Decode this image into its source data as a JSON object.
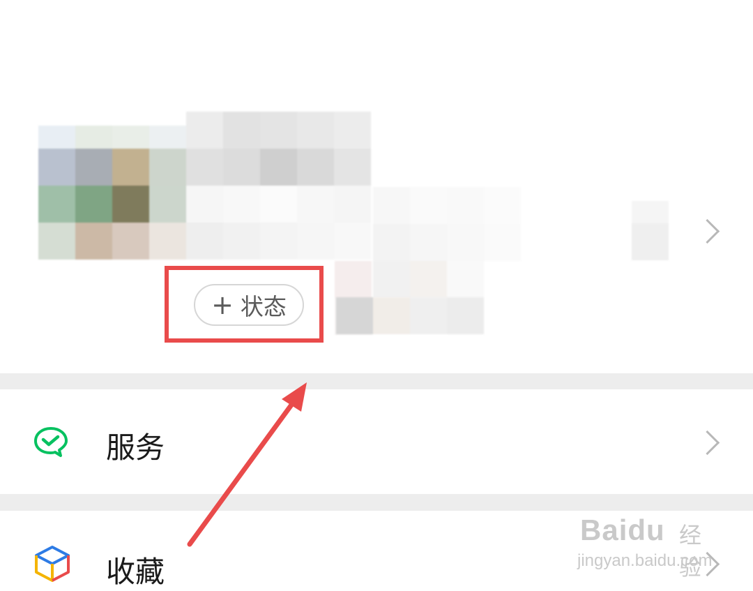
{
  "profile": {
    "status_button": {
      "plus": "+",
      "label": "状态"
    }
  },
  "menu": [
    {
      "id": "services",
      "label": "服务",
      "icon": "wechat-pay-icon"
    },
    {
      "id": "favorites",
      "label": "收藏",
      "icon": "cube-icon"
    }
  ],
  "watermark": {
    "brand": "Baidu",
    "cn": "经验",
    "url": "jingyan.baidu.com"
  },
  "colors": {
    "accent_red": "#e94b4b",
    "wechat_green": "#07c160",
    "divider": "#ededed",
    "chevron": "#b8b8b8"
  }
}
